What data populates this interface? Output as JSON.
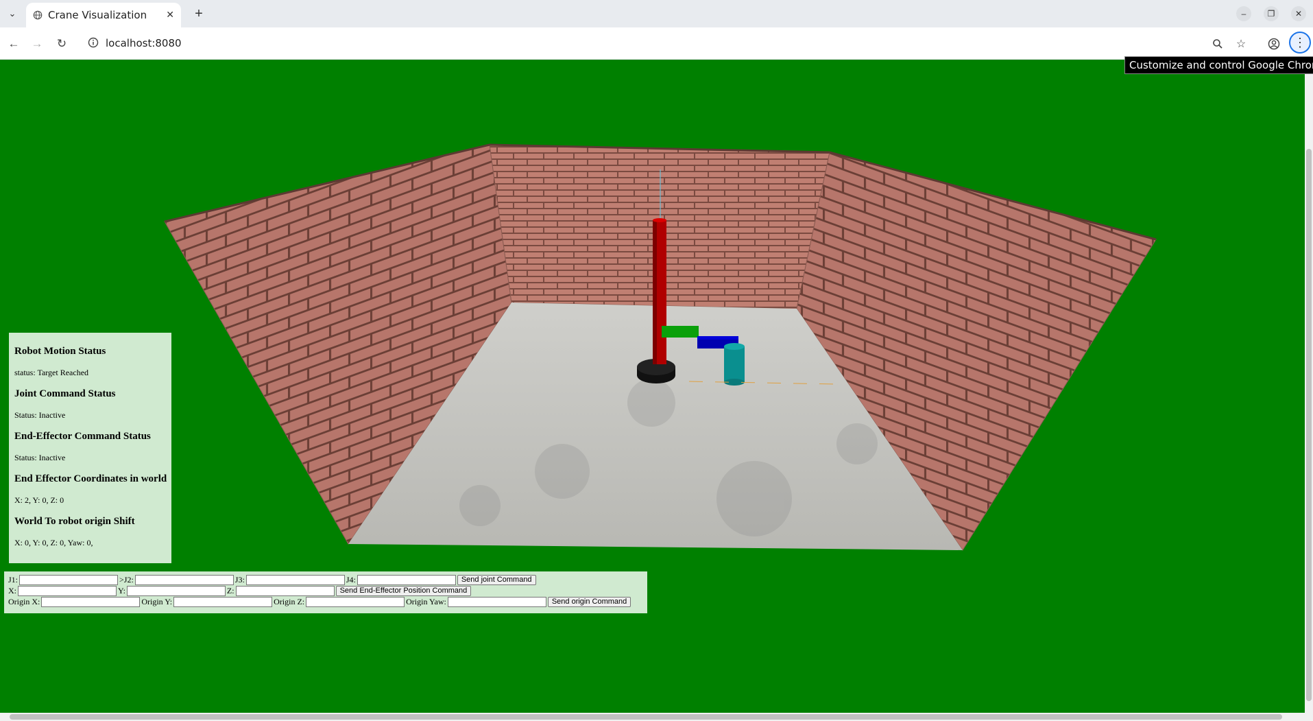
{
  "browser": {
    "tab_title": "Crane Visualization",
    "url": "localhost:8080",
    "tooltip": "Customize and control Google Chrome"
  },
  "scene": {
    "background_color": "#008000",
    "description_icons": [
      "brick-wall",
      "concrete-floor",
      "crane-robot"
    ]
  },
  "status_panel": {
    "robot_motion_title": "Robot Motion Status",
    "robot_motion_status": "status: Target Reached",
    "joint_command_title": "Joint Command Status",
    "joint_command_status": "Status: Inactive",
    "ee_command_title": "End-Effector Command Status",
    "ee_command_status": "Status: Inactive",
    "ee_coords_title": "End Effector Coordinates in world",
    "ee_coords_value": "X: 2, Y: 0, Z: 0",
    "origin_shift_title": "World To robot origin Shift",
    "origin_shift_value": "X: 0, Y: 0, Z: 0, Yaw: 0,"
  },
  "command_panel": {
    "j1_label": "J1:",
    "j2_label": ">J2:",
    "j3_label": "J3:",
    "j4_label": "J4:",
    "j1_value": "",
    "j2_value": "",
    "j3_value": "",
    "j4_value": "",
    "send_joint": "Send joint Command",
    "x_label": "X:",
    "y_label": "Y:",
    "z_label": "Z:",
    "x_value": "",
    "y_value": "",
    "z_value": "",
    "send_ee": "Send End-Effector Position Command",
    "origin_x_label": "Origin X:",
    "origin_y_label": "Origin Y:",
    "origin_z_label": "Origin Z:",
    "origin_yaw_label": "Origin Yaw:",
    "origin_x_value": "",
    "origin_y_value": "",
    "origin_z_value": "",
    "origin_yaw_value": "",
    "send_origin": "Send origin Command"
  }
}
